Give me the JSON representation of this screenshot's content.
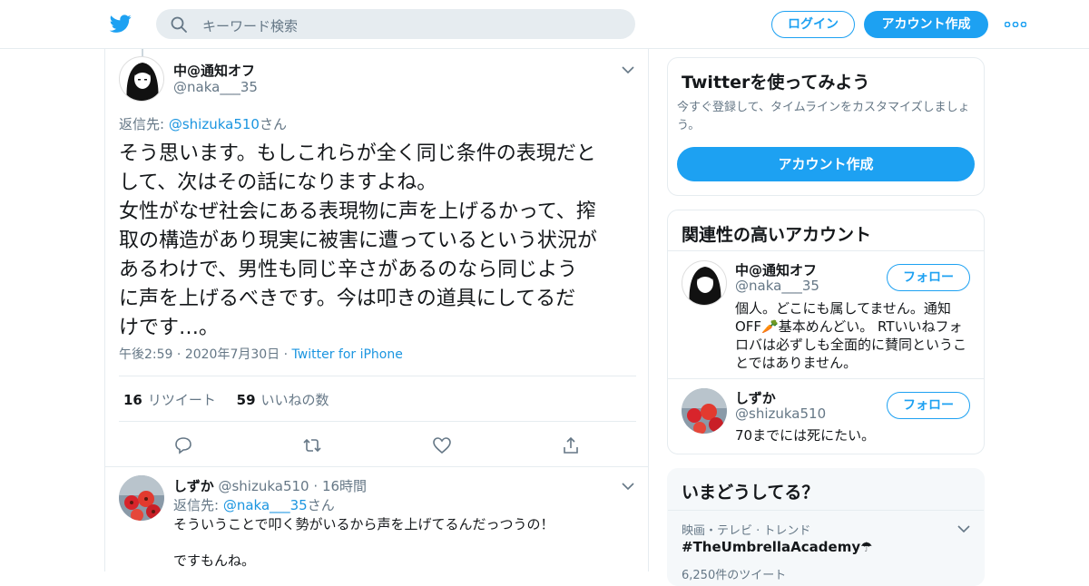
{
  "header": {
    "logo_icon": "twitter-bird-icon",
    "search_placeholder": "キーワード検索",
    "login_label": "ログイン",
    "signup_label": "アカウント作成",
    "accent": "#1da1f2"
  },
  "tweet": {
    "author_name": "中@通知オフ",
    "author_handle": "@naka___35",
    "reply_prefix": "返信先: ",
    "reply_handle": "@shizuka510",
    "reply_suffix": "さん",
    "text": "そう思います。もしこれらが全く同じ条件の表現だと\nして、次はその話になりますよね。\n女性がなぜ社会にある表現物に声を上げるかって、搾\n取の構造があり現実に被害に遭っているという状況が\nあるわけで、男性も同じ辛さがあるのなら同じよう\nに声を上げるべきです。今は叩きの道具にしてるだ\nけです…。",
    "time": "午後2:59",
    "date": "2020年7月30日",
    "source": "Twitter for iPhone",
    "retweet_count": "16",
    "retweet_label": "リツイート",
    "like_count": "59",
    "like_label": "いいねの数"
  },
  "reply": {
    "author_name": "しずか",
    "author_handle": "@shizuka510",
    "time_ago": "16時間",
    "reply_prefix": "返信先: ",
    "reply_handle": "@naka___35",
    "reply_suffix": "さん",
    "text": "そういうことで叩く勢がいるから声を上げてるんだっつうの！\n\nですもんね。"
  },
  "signup_card": {
    "title": "Twitterを使ってみよう",
    "description": "今すぐ登録して、タイムラインをカスタマイズしましょう。",
    "button_label": "アカウント作成"
  },
  "related": {
    "title": "関連性の高いアカウント",
    "follow_label": "フォロー",
    "accounts": [
      {
        "name": "中@通知オフ",
        "handle": "@naka___35",
        "bio": "個人。どこにも属してません。通知OFF🥕基本めんどい。 RTいいねフォロバは必ずしも全面的に賛同ということではありません。"
      },
      {
        "name": "しずか",
        "handle": "@shizuka510",
        "bio": "70までには死にたい。"
      }
    ]
  },
  "trends": {
    "title": "いまどうしてる？",
    "category": "映画・テレビ · トレンド",
    "tag": "#TheUmbrellaAcademy☂",
    "count": "6,250件のツイート"
  }
}
